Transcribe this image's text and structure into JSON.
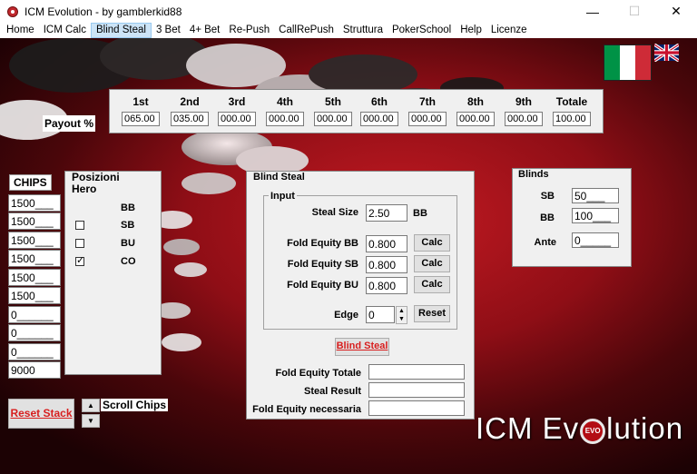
{
  "window": {
    "title": "ICM Evolution - by gamblerkid88",
    "controls": {
      "minimize": "—",
      "maximize": "☐",
      "close": "✕"
    }
  },
  "menu": [
    "Home",
    "ICM Calc",
    "Blind Steal",
    "3 Bet",
    "4+ Bet",
    "Re-Push",
    "CallRePush",
    "Struttura",
    "PokerSchool",
    "Help",
    "Licenze"
  ],
  "payout": {
    "label": "Payout %",
    "headers": [
      "1st",
      "2nd",
      "3rd",
      "4th",
      "5th",
      "6th",
      "7th",
      "8th",
      "9th",
      "Totale"
    ],
    "values": [
      "065.00",
      "035.00",
      "000.00",
      "000.00",
      "000.00",
      "000.00",
      "000.00",
      "000.00",
      "000.00",
      "100.00"
    ]
  },
  "chips": {
    "label": "CHIPS",
    "values": [
      "1500___",
      "1500___",
      "1500___",
      "1500___",
      "1500___",
      "1500___",
      "0______",
      "0______",
      "0______",
      "9000"
    ]
  },
  "posizioni": {
    "title": "Posizioni Hero",
    "rows": [
      {
        "label": "BB",
        "has_checkbox": false,
        "checked": false
      },
      {
        "label": "SB",
        "has_checkbox": true,
        "checked": false
      },
      {
        "label": "BU",
        "has_checkbox": true,
        "checked": false
      },
      {
        "label": "CO",
        "has_checkbox": true,
        "checked": true
      }
    ]
  },
  "blind_steal": {
    "title": "Blind Steal",
    "input_group_title": "Input",
    "steal_size_label": "Steal Size",
    "steal_size_value": "2.50",
    "steal_size_unit": "BB",
    "fe_bb_label": "Fold Equity BB",
    "fe_bb_value": "0.800",
    "fe_sb_label": "Fold Equity SB",
    "fe_sb_value": "0.800",
    "fe_bu_label": "Fold Equity BU",
    "fe_bu_value": "0.800",
    "calc_label": "Calc",
    "edge_label": "Edge",
    "edge_value": "0",
    "reset_label": "Reset",
    "action_label": "Blind Steal",
    "fe_totale_label": "Fold Equity Totale",
    "fe_totale_value": "",
    "steal_result_label": "Steal Result",
    "steal_result_value": "",
    "fe_necessaria_label": "Fold Equity necessaria",
    "fe_necessaria_value": ""
  },
  "blinds": {
    "title": "Blinds",
    "sb_label": "SB",
    "sb_value": "50___",
    "bb_label": "BB",
    "bb_value": "100___",
    "ante_label": "Ante",
    "ante_value": "0_____"
  },
  "bottom": {
    "reset_stack_label": "Reset Stack",
    "scroll_chips_label": "Scroll Chips",
    "scroll_up_glyph": "▲",
    "scroll_down_glyph": "▼"
  },
  "logo": {
    "part1": "ICM Ev",
    "badge": "EVO",
    "part2": "lution"
  },
  "colors": {
    "accent_red": "#d81e1e",
    "flag_green": "#009246",
    "flag_white": "#ffffff",
    "flag_red": "#ce2b37"
  }
}
